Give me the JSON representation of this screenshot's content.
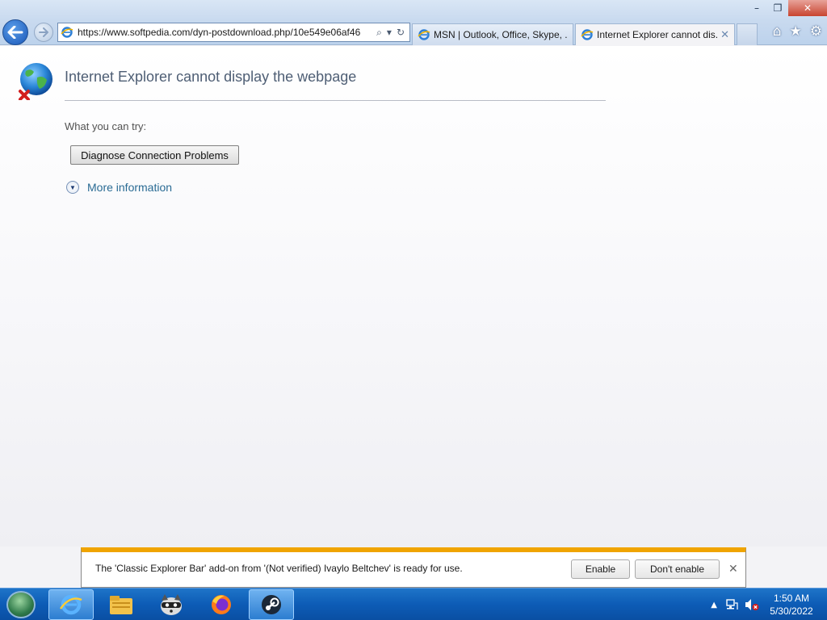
{
  "window": {
    "minimize_glyph": "–",
    "restore_glyph": "❐",
    "close_glyph": "✕"
  },
  "address_bar": {
    "url": "https://www.softpedia.com/dyn-postdownload.php/10e549e06af46"
  },
  "tabs": [
    {
      "label": "MSN | Outlook, Office, Skype, ...",
      "icon": "ie-icon"
    },
    {
      "label": "Internet Explorer cannot dis...",
      "icon": "ie-icon",
      "close": "✕"
    }
  ],
  "command_icons": [
    "home-icon",
    "favorites-star-icon",
    "settings-gear-icon"
  ],
  "page": {
    "title": "Internet Explorer cannot display the webpage",
    "try_label": "What you can try:",
    "diagnose_button": "Diagnose Connection Problems",
    "more_info": "More information"
  },
  "notification": {
    "message": "The 'Classic Explorer Bar' add-on from '(Not verified) Ivaylo Beltchev' is ready for use.",
    "enable": "Enable",
    "dont_enable": "Don't enable",
    "close": "✕",
    "accent_color": "#f0a400"
  },
  "taskbar": {
    "items": [
      "internet-explorer",
      "file-explorer",
      "raccoon-app",
      "firefox",
      "steam"
    ],
    "tray_up": "▲",
    "clock_time": "1:50 AM",
    "clock_date": "5/30/2022"
  }
}
